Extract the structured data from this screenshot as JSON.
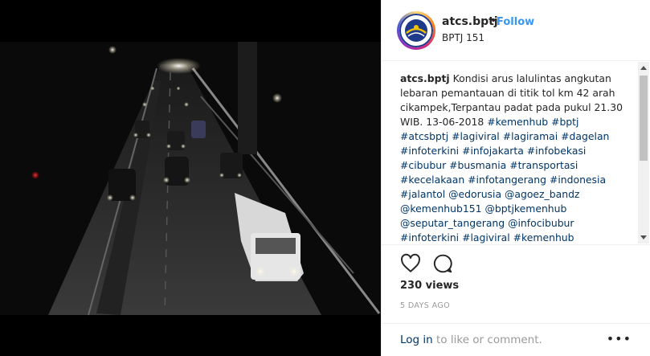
{
  "post": {
    "username": "atcs.bptj",
    "separator": "•",
    "follow_label": "Follow",
    "subtitle": "BPTJ 151"
  },
  "caption": {
    "username": "atcs.bptj",
    "text": "Kondisi arus lalulintas angkutan lebaran pemantauan di titik tol km 42 arah cikampek,Terpantau padat pada pukul 21.30 WIB. 13-06-2018",
    "tags": [
      "#kemenhub",
      "#bptj",
      "#atcsbptj",
      "#lagiviral",
      "#lagiramai",
      "#dagelan",
      "#infoterkini",
      "#infojakarta",
      "#infobekasi",
      "#cibubur",
      "#busmania",
      "#transportasi",
      "#kecelakaan",
      "#infotangerang",
      "#indonesia",
      "#jalantol",
      "@edorusia",
      "@agoez_bandz",
      "@kemenhub151",
      "@bptjkemenhub",
      "@seputar_tangerang",
      "@infocibubur",
      "#infoterkini",
      "#lagiviral",
      "#kemenhub"
    ]
  },
  "icons": {
    "like": "heart-icon",
    "comment": "comment-icon",
    "more": "more-icon"
  },
  "stats": {
    "views": "230 views",
    "time_ago": "5 DAYS AGO"
  },
  "footer": {
    "login_link": "Log in",
    "login_rest": " to like or comment.",
    "more_label": "•••"
  },
  "colors": {
    "link": "#003569",
    "follow": "#3897f0",
    "text": "#262626",
    "muted": "#999999"
  }
}
